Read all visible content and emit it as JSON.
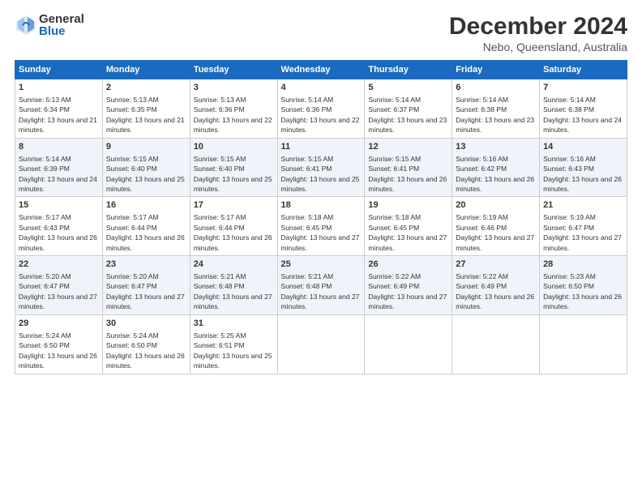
{
  "logo": {
    "general": "General",
    "blue": "Blue"
  },
  "header": {
    "title": "December 2024",
    "subtitle": "Nebo, Queensland, Australia"
  },
  "days_of_week": [
    "Sunday",
    "Monday",
    "Tuesday",
    "Wednesday",
    "Thursday",
    "Friday",
    "Saturday"
  ],
  "weeks": [
    [
      {
        "day": "1",
        "sunrise": "Sunrise: 5:13 AM",
        "sunset": "Sunset: 6:34 PM",
        "daylight": "Daylight: 13 hours and 21 minutes."
      },
      {
        "day": "2",
        "sunrise": "Sunrise: 5:13 AM",
        "sunset": "Sunset: 6:35 PM",
        "daylight": "Daylight: 13 hours and 21 minutes."
      },
      {
        "day": "3",
        "sunrise": "Sunrise: 5:13 AM",
        "sunset": "Sunset: 6:36 PM",
        "daylight": "Daylight: 13 hours and 22 minutes."
      },
      {
        "day": "4",
        "sunrise": "Sunrise: 5:14 AM",
        "sunset": "Sunset: 6:36 PM",
        "daylight": "Daylight: 13 hours and 22 minutes."
      },
      {
        "day": "5",
        "sunrise": "Sunrise: 5:14 AM",
        "sunset": "Sunset: 6:37 PM",
        "daylight": "Daylight: 13 hours and 23 minutes."
      },
      {
        "day": "6",
        "sunrise": "Sunrise: 5:14 AM",
        "sunset": "Sunset: 6:38 PM",
        "daylight": "Daylight: 13 hours and 23 minutes."
      },
      {
        "day": "7",
        "sunrise": "Sunrise: 5:14 AM",
        "sunset": "Sunset: 6:38 PM",
        "daylight": "Daylight: 13 hours and 24 minutes."
      }
    ],
    [
      {
        "day": "8",
        "sunrise": "Sunrise: 5:14 AM",
        "sunset": "Sunset: 6:39 PM",
        "daylight": "Daylight: 13 hours and 24 minutes."
      },
      {
        "day": "9",
        "sunrise": "Sunrise: 5:15 AM",
        "sunset": "Sunset: 6:40 PM",
        "daylight": "Daylight: 13 hours and 25 minutes."
      },
      {
        "day": "10",
        "sunrise": "Sunrise: 5:15 AM",
        "sunset": "Sunset: 6:40 PM",
        "daylight": "Daylight: 13 hours and 25 minutes."
      },
      {
        "day": "11",
        "sunrise": "Sunrise: 5:15 AM",
        "sunset": "Sunset: 6:41 PM",
        "daylight": "Daylight: 13 hours and 25 minutes."
      },
      {
        "day": "12",
        "sunrise": "Sunrise: 5:15 AM",
        "sunset": "Sunset: 6:41 PM",
        "daylight": "Daylight: 13 hours and 26 minutes."
      },
      {
        "day": "13",
        "sunrise": "Sunrise: 5:16 AM",
        "sunset": "Sunset: 6:42 PM",
        "daylight": "Daylight: 13 hours and 26 minutes."
      },
      {
        "day": "14",
        "sunrise": "Sunrise: 5:16 AM",
        "sunset": "Sunset: 6:43 PM",
        "daylight": "Daylight: 13 hours and 26 minutes."
      }
    ],
    [
      {
        "day": "15",
        "sunrise": "Sunrise: 5:17 AM",
        "sunset": "Sunset: 6:43 PM",
        "daylight": "Daylight: 13 hours and 26 minutes."
      },
      {
        "day": "16",
        "sunrise": "Sunrise: 5:17 AM",
        "sunset": "Sunset: 6:44 PM",
        "daylight": "Daylight: 13 hours and 26 minutes."
      },
      {
        "day": "17",
        "sunrise": "Sunrise: 5:17 AM",
        "sunset": "Sunset: 6:44 PM",
        "daylight": "Daylight: 13 hours and 26 minutes."
      },
      {
        "day": "18",
        "sunrise": "Sunrise: 5:18 AM",
        "sunset": "Sunset: 6:45 PM",
        "daylight": "Daylight: 13 hours and 27 minutes."
      },
      {
        "day": "19",
        "sunrise": "Sunrise: 5:18 AM",
        "sunset": "Sunset: 6:45 PM",
        "daylight": "Daylight: 13 hours and 27 minutes."
      },
      {
        "day": "20",
        "sunrise": "Sunrise: 5:19 AM",
        "sunset": "Sunset: 6:46 PM",
        "daylight": "Daylight: 13 hours and 27 minutes."
      },
      {
        "day": "21",
        "sunrise": "Sunrise: 5:19 AM",
        "sunset": "Sunset: 6:47 PM",
        "daylight": "Daylight: 13 hours and 27 minutes."
      }
    ],
    [
      {
        "day": "22",
        "sunrise": "Sunrise: 5:20 AM",
        "sunset": "Sunset: 6:47 PM",
        "daylight": "Daylight: 13 hours and 27 minutes."
      },
      {
        "day": "23",
        "sunrise": "Sunrise: 5:20 AM",
        "sunset": "Sunset: 6:47 PM",
        "daylight": "Daylight: 13 hours and 27 minutes."
      },
      {
        "day": "24",
        "sunrise": "Sunrise: 5:21 AM",
        "sunset": "Sunset: 6:48 PM",
        "daylight": "Daylight: 13 hours and 27 minutes."
      },
      {
        "day": "25",
        "sunrise": "Sunrise: 5:21 AM",
        "sunset": "Sunset: 6:48 PM",
        "daylight": "Daylight: 13 hours and 27 minutes."
      },
      {
        "day": "26",
        "sunrise": "Sunrise: 5:22 AM",
        "sunset": "Sunset: 6:49 PM",
        "daylight": "Daylight: 13 hours and 27 minutes."
      },
      {
        "day": "27",
        "sunrise": "Sunrise: 5:22 AM",
        "sunset": "Sunset: 6:49 PM",
        "daylight": "Daylight: 13 hours and 26 minutes."
      },
      {
        "day": "28",
        "sunrise": "Sunrise: 5:23 AM",
        "sunset": "Sunset: 6:50 PM",
        "daylight": "Daylight: 13 hours and 26 minutes."
      }
    ],
    [
      {
        "day": "29",
        "sunrise": "Sunrise: 5:24 AM",
        "sunset": "Sunset: 6:50 PM",
        "daylight": "Daylight: 13 hours and 26 minutes."
      },
      {
        "day": "30",
        "sunrise": "Sunrise: 5:24 AM",
        "sunset": "Sunset: 6:50 PM",
        "daylight": "Daylight: 13 hours and 26 minutes."
      },
      {
        "day": "31",
        "sunrise": "Sunrise: 5:25 AM",
        "sunset": "Sunset: 6:51 PM",
        "daylight": "Daylight: 13 hours and 25 minutes."
      },
      null,
      null,
      null,
      null
    ]
  ]
}
